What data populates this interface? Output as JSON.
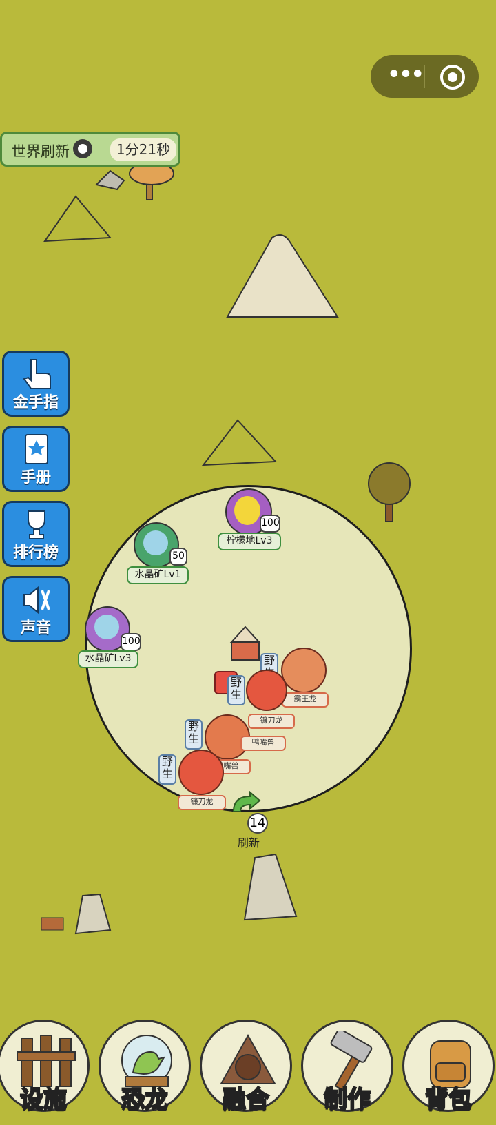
{
  "world_refresh": {
    "label": "世界刷新",
    "time": "1分21秒"
  },
  "side_menu": [
    {
      "label": "金手指",
      "icon": "pointing-hand-icon"
    },
    {
      "label": "手册",
      "icon": "book-star-icon"
    },
    {
      "label": "排行榜",
      "icon": "trophy-icon"
    },
    {
      "label": "声音",
      "icon": "speaker-muted-icon"
    }
  ],
  "resources": [
    {
      "label": "柠檬地Lv3",
      "count": "100",
      "icon": "lemon-icon"
    },
    {
      "label": "水晶矿Lv1",
      "count": "50",
      "icon": "crystal-icon"
    },
    {
      "label": "水晶矿Lv3",
      "count": "100",
      "icon": "crystal-icon"
    }
  ],
  "wild_tag": "野生",
  "dinos": [
    {
      "label": "霸王龙"
    },
    {
      "label": "镰刀龙"
    },
    {
      "label": "鸭嘴兽"
    },
    {
      "label": "鸭嘴兽"
    },
    {
      "label": "镰刀龙"
    }
  ],
  "refresh": {
    "count": "14",
    "label": "刷新"
  },
  "bottom_nav": [
    {
      "label": "设施",
      "icon": "fence-icon"
    },
    {
      "label": "恐龙",
      "icon": "dino-globe-icon"
    },
    {
      "label": "融合",
      "icon": "fusion-icon"
    },
    {
      "label": "制作",
      "icon": "hammer-icon"
    },
    {
      "label": "背包",
      "icon": "backpack-icon"
    }
  ],
  "colors": {
    "grass": "#b9ba3b",
    "territory": "#e6e6b9",
    "button_blue": "#2b8ee0"
  }
}
